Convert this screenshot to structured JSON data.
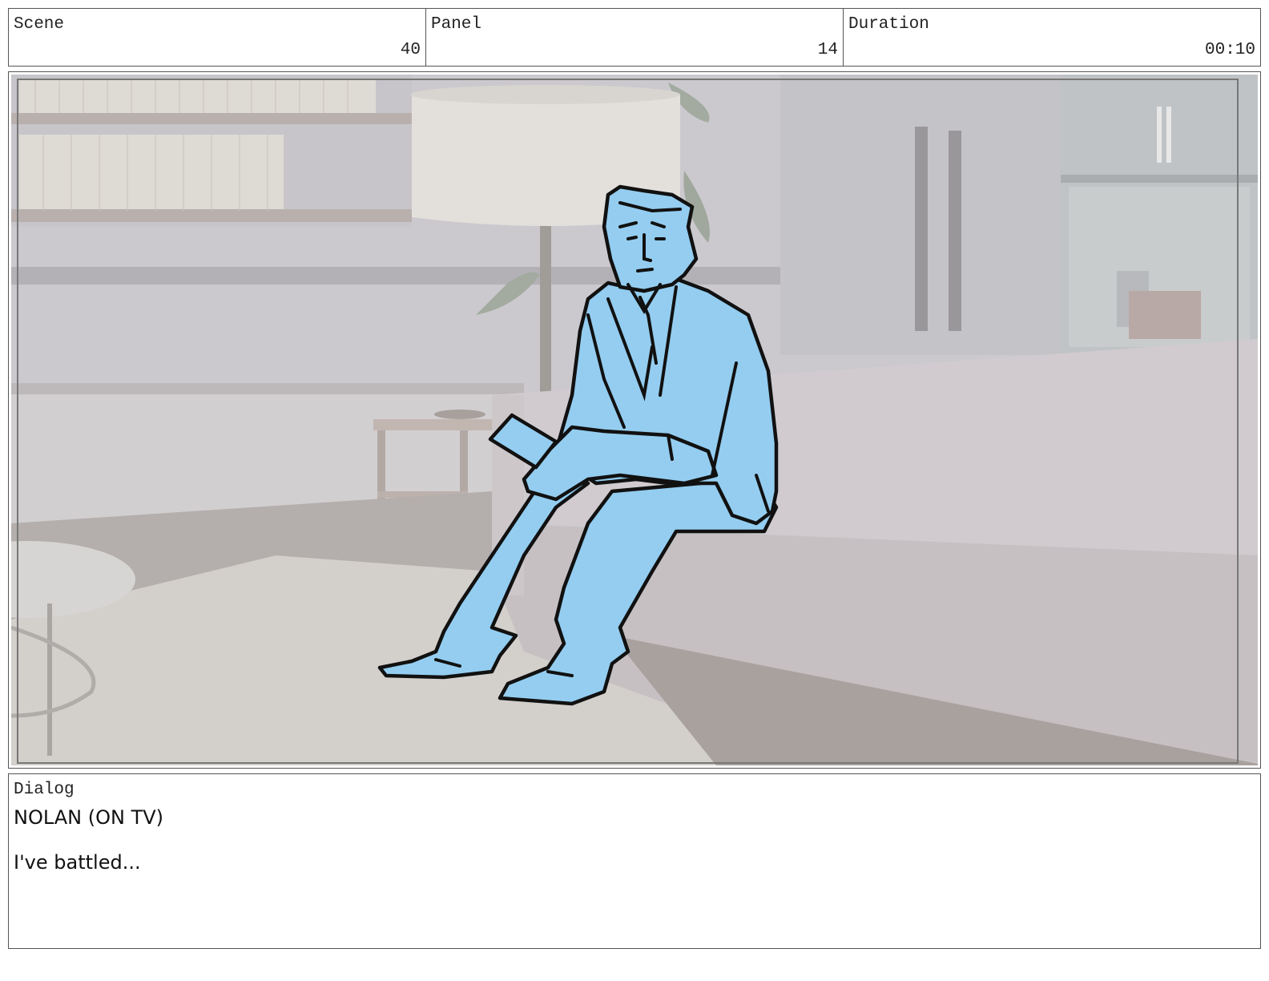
{
  "header": {
    "scene": {
      "label": "Scene",
      "value": "40"
    },
    "panel": {
      "label": "Panel",
      "value": "14"
    },
    "duration": {
      "label": "Duration",
      "value": "00:10"
    }
  },
  "panel_image": {
    "description_icon": "storyboard-sketch",
    "colors": {
      "background_wall": "#c9c7cc",
      "floor": "#d4d1cd",
      "character_fill": "#94cdf0",
      "outline": "#111111"
    }
  },
  "dialog": {
    "label": "Dialog",
    "speaker": "NOLAN (ON TV)",
    "line": "I've battled..."
  }
}
